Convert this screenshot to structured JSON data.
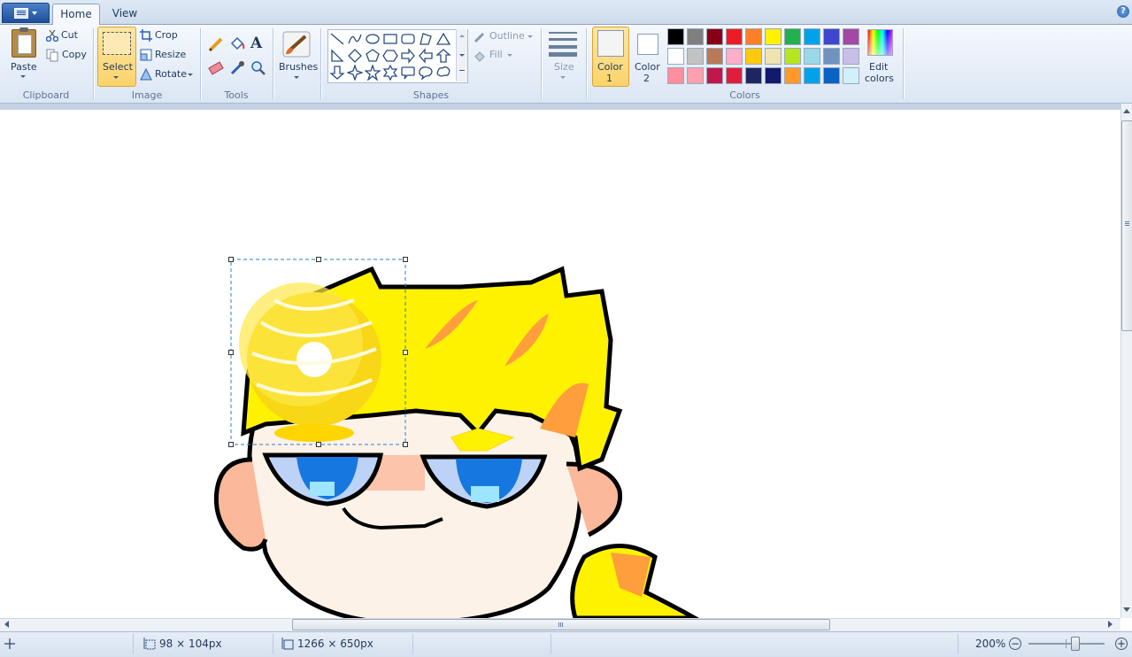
{
  "tabs": {
    "home": "Home",
    "view": "View"
  },
  "help_icon": "?",
  "clipboard": {
    "paste": "Paste",
    "cut": "Cut",
    "copy": "Copy",
    "group": "Clipboard"
  },
  "image": {
    "select": "Select",
    "crop": "Crop",
    "resize": "Resize",
    "rotate": "Rotate",
    "group": "Image"
  },
  "tools": {
    "group": "Tools",
    "text_tool_glyph": "A"
  },
  "brushes": {
    "label": "Brushes"
  },
  "shapes": {
    "group": "Shapes",
    "outline": "Outline",
    "fill": "Fill"
  },
  "size": {
    "label": "Size"
  },
  "colors": {
    "group": "Colors",
    "color1_line1": "Color",
    "color1_line2": "1",
    "color2_line1": "Color",
    "color2_line2": "2",
    "edit_line1": "Edit",
    "edit_line2": "colors",
    "color1_value": "#f4f4f4",
    "color2_value": "#ffffff",
    "palette": [
      [
        "#000000",
        "#7f7f7f",
        "#880015",
        "#ed1c24",
        "#ff7f27",
        "#fff200",
        "#22b14c",
        "#00a2e8",
        "#3f48cc",
        "#a349a4"
      ],
      [
        "#ffffff",
        "#c3c3c3",
        "#b97a57",
        "#ffaec9",
        "#ffc90e",
        "#efe4b0",
        "#b5e61d",
        "#99d9ea",
        "#7092be",
        "#c8bfe7"
      ],
      [
        "#ff8f9f",
        "#ffa0b0",
        "#c0184a",
        "#e01e3c",
        "#1f2560",
        "#121a6e",
        "#ff9a2a",
        "#00a2e8",
        "#0a62c4",
        "#d2f0fa"
      ]
    ]
  },
  "status": {
    "selection_size": "98 × 104px",
    "image_size": "1266 × 650px",
    "zoom": "200%",
    "zoom_fraction": 0.6
  }
}
